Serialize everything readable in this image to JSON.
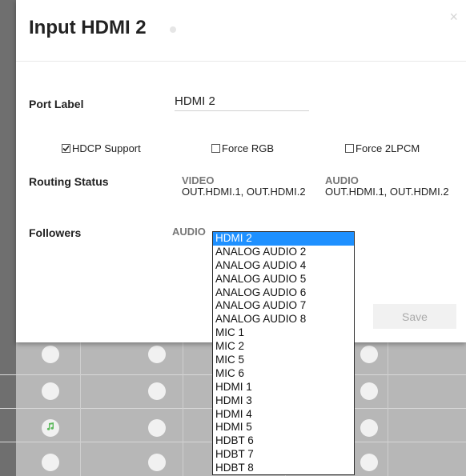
{
  "modal": {
    "title": "Input HDMI 2",
    "close_label": "×",
    "port_label": {
      "label": "Port Label",
      "value": "HDMI 2"
    },
    "checkboxes": [
      {
        "label": "HDCP Support",
        "checked": true
      },
      {
        "label": "Force RGB",
        "checked": false
      },
      {
        "label": "Force 2LPCM",
        "checked": false
      }
    ],
    "routing_status": {
      "label": "Routing Status",
      "video_header": "VIDEO",
      "video_value": "OUT.HDMI.1, OUT.HDMI.2",
      "audio_header": "AUDIO",
      "audio_value": "OUT.HDMI.1, OUT.HDMI.2"
    },
    "followers": {
      "label": "Followers",
      "audio_label": "AUDIO"
    },
    "save_label": "Save"
  },
  "audio_dropdown": {
    "selected": "HDMI 2",
    "options": [
      "HDMI 2",
      "ANALOG AUDIO 2",
      "ANALOG AUDIO 4",
      "ANALOG AUDIO 5",
      "ANALOG AUDIO 6",
      "ANALOG AUDIO 7",
      "ANALOG AUDIO 8",
      "MIC 1",
      "MIC 2",
      "MIC 5",
      "MIC 6",
      "HDMI 1",
      "HDMI 3",
      "HDMI 4",
      "HDMI 5",
      "HDBT 6",
      "HDBT 7",
      "HDBT 8"
    ]
  },
  "colors": {
    "selected_option": "#1e90ff",
    "music_icon": "#5cb85c"
  }
}
